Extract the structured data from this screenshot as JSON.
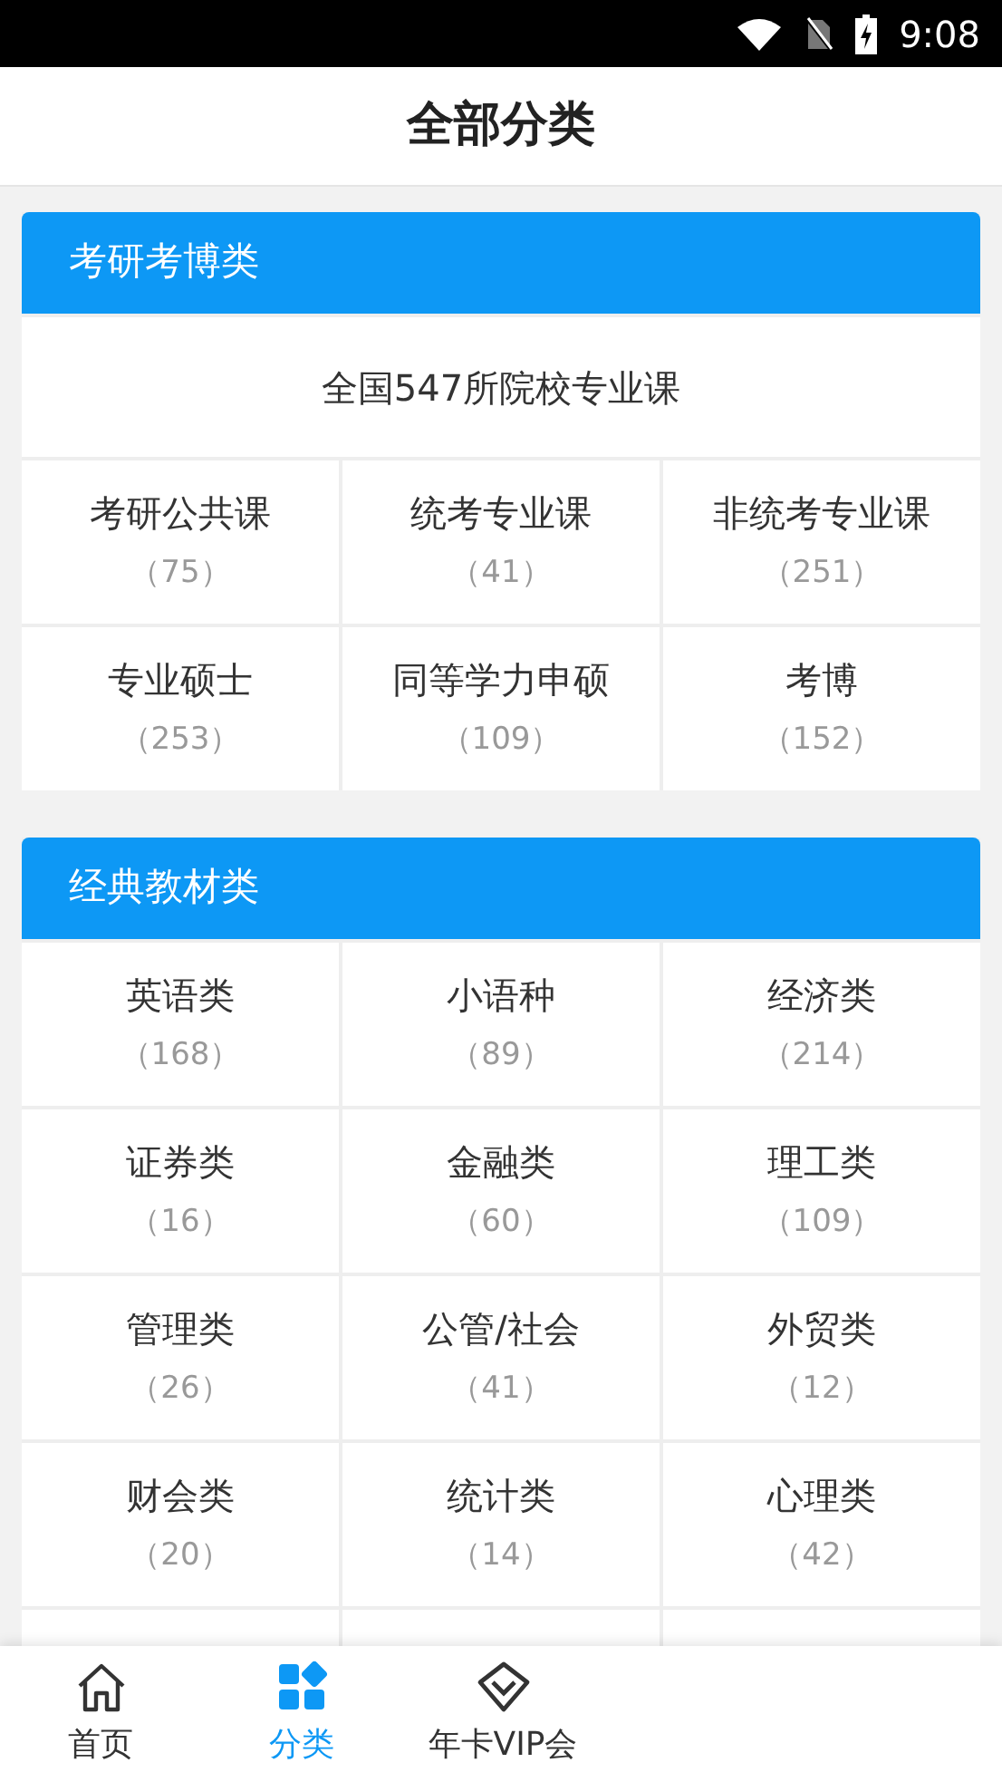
{
  "status_bar": {
    "time": "9:08"
  },
  "header": {
    "title": "全部分类"
  },
  "sections": [
    {
      "title": "考研考博类",
      "feature": "全国547所院校专业课",
      "items": [
        {
          "name": "考研公共课",
          "count": "（75）"
        },
        {
          "name": "统考专业课",
          "count": "（41）"
        },
        {
          "name": "非统考专业课",
          "count": "（251）"
        },
        {
          "name": "专业硕士",
          "count": "（253）"
        },
        {
          "name": "同等学力申硕",
          "count": "（109）"
        },
        {
          "name": "考博",
          "count": "（152）"
        }
      ]
    },
    {
      "title": "经典教材类",
      "items": [
        {
          "name": "英语类",
          "count": "（168）"
        },
        {
          "name": "小语种",
          "count": "（89）"
        },
        {
          "name": "经济类",
          "count": "（214）"
        },
        {
          "name": "证券类",
          "count": "（16）"
        },
        {
          "name": "金融类",
          "count": "（60）"
        },
        {
          "name": "理工类",
          "count": "（109）"
        },
        {
          "name": "管理类",
          "count": "（26）"
        },
        {
          "name": "公管/社会",
          "count": "（41）"
        },
        {
          "name": "外贸类",
          "count": "（12）"
        },
        {
          "name": "财会类",
          "count": "（20）"
        },
        {
          "name": "统计类",
          "count": "（14）"
        },
        {
          "name": "心理类",
          "count": "（42）"
        }
      ]
    }
  ],
  "tab_bar": [
    {
      "label": "首页",
      "kind": "home",
      "selected": false
    },
    {
      "label": "分类",
      "kind": "grid",
      "selected": true
    },
    {
      "label": "年卡VIP会",
      "kind": "diamond",
      "selected": false
    }
  ]
}
